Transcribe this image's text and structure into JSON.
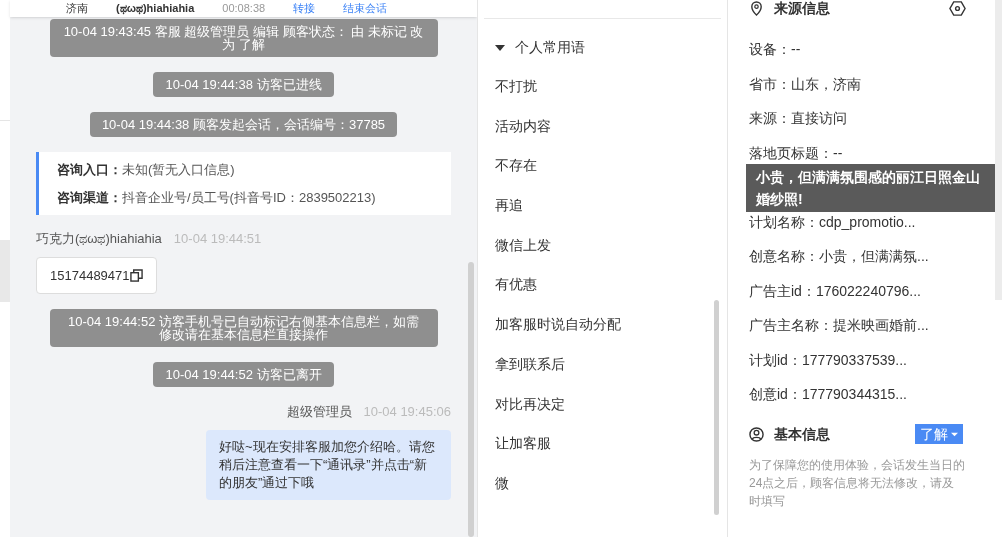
{
  "chat_header": {
    "city": "济南",
    "visitor": "(ಥωಥ)hiahiahia",
    "duration": "00:08:38",
    "actions": [
      "转接",
      "结束会话"
    ]
  },
  "messages": [
    {
      "kind": "notice",
      "text": "10-04 19:43:45 客服 超级管理员 编辑 顾客状态： 由 未标记 改为 了解"
    },
    {
      "kind": "notice",
      "text": "10-04 19:44:38 访客已进线"
    },
    {
      "kind": "notice",
      "text": "10-04 19:44:38 顾客发起会话，会话编号：37785"
    },
    {
      "kind": "entry",
      "lines": [
        {
          "label": "咨询入口：",
          "value": "未知(暂无入口信息)"
        },
        {
          "label": "咨询渠道：",
          "value": "抖音企业号/员工号(抖音号ID：2839502213)"
        }
      ]
    },
    {
      "kind": "visitor",
      "sender": "巧克力(ಥωಥ)hiahiahia",
      "time": "10-04 19:44:51",
      "text": "15174489471"
    },
    {
      "kind": "notice",
      "text": "10-04 19:44:52 访客手机号已自动标记右侧基本信息栏，如需修改请在基本信息栏直接操作"
    },
    {
      "kind": "notice",
      "text": "10-04 19:44:52 访客已离开"
    },
    {
      "kind": "agent",
      "sender": "超级管理员",
      "time": "10-04 19:45:06",
      "text": "好哒~现在安排客服加您介绍哈。请您稍后注意查看一下“通讯录”并点击“新的朋友”通过下哦"
    }
  ],
  "phrases": {
    "group": "个人常用语",
    "expanded": true,
    "items": [
      "不打扰",
      "活动内容",
      "不存在",
      "再追",
      "微信上发",
      "有优惠",
      "加客服时说自动分配",
      "拿到联系后",
      "对比再决定",
      "让加客服",
      "微"
    ]
  },
  "source_info": {
    "title": "来源信息",
    "fields": [
      {
        "kind": "field",
        "text": "设备：--"
      },
      {
        "kind": "field",
        "text": "省市：山东，济南"
      },
      {
        "kind": "field",
        "text": "来源：直接访问"
      },
      {
        "kind": "field",
        "text": "落地页标题：--"
      },
      {
        "kind": "tooltip",
        "text": "小贵，但满满氛围感的丽江日照金山婚纱照!"
      },
      {
        "kind": "field",
        "text": "计划名称：cdp_promotio..."
      },
      {
        "kind": "field",
        "text": "创意名称：小贵，但满满氛..."
      },
      {
        "kind": "field",
        "text": "广告主id：176022240796..."
      },
      {
        "kind": "field",
        "text": "广告主名称：提米映画婚前..."
      },
      {
        "kind": "field",
        "text": "计划id：177790337539..."
      },
      {
        "kind": "field",
        "text": "创意id：177790344315..."
      }
    ]
  },
  "basic_info": {
    "title": "基本信息",
    "status": "了解",
    "note": "为了保障您的使用体验，会话发生当日的24点之后，顾客信息将无法修改，请及时填写"
  }
}
